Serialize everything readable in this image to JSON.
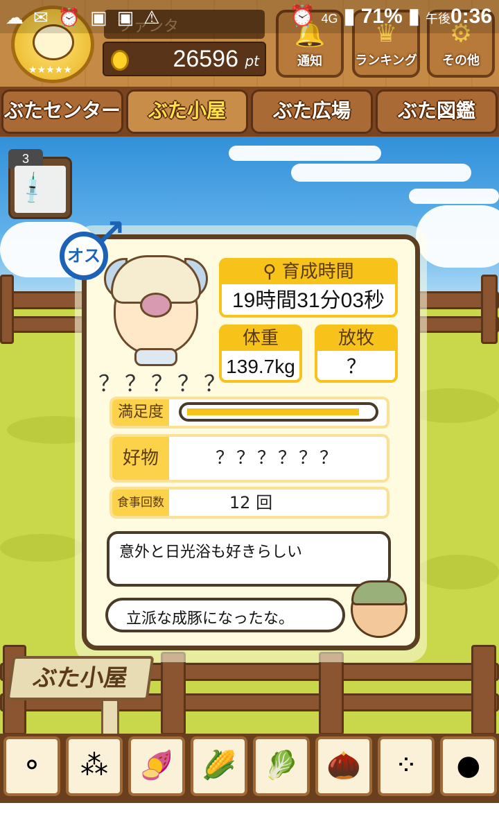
{
  "status_bar": {
    "battery_percent": "71%",
    "time_period": "午後",
    "time": "0:36",
    "network": "4G"
  },
  "header": {
    "player_name": "ファンタ",
    "points_value": "26596",
    "points_unit": "pt",
    "buttons": [
      {
        "label": "通知",
        "icon": "bell-icon"
      },
      {
        "label": "ランキング",
        "icon": "crown-icon"
      },
      {
        "label": "その他",
        "icon": "gear-icon"
      }
    ]
  },
  "tabs": [
    {
      "label": "ぶたセンター",
      "active": false
    },
    {
      "label": "ぶた小屋",
      "active": true
    },
    {
      "label": "ぶた広場",
      "active": false
    },
    {
      "label": "ぶた図鑑",
      "active": false
    }
  ],
  "item": {
    "count": "3",
    "icon": "syringe-icon"
  },
  "pig": {
    "gender": "オス",
    "name": "？？？？？",
    "growth_time_label": "育成時間",
    "growth_time_value": "19時間31分03秒",
    "weight_label": "体重",
    "weight_value": "139.7kg",
    "release_label": "放牧",
    "release_value": "？",
    "satisfaction_label": "満足度",
    "satisfaction_level": 0.94,
    "favorite_label": "好物",
    "favorite_value": "？？？？？？",
    "meals_label": "食事回数",
    "meals_value": "12 回",
    "hint": "意外と日光浴も好きらしい",
    "farmer_comment": "立派な成豚になったな。"
  },
  "signboard": "ぶた小屋",
  "foods": [
    {
      "name": "grain-pellets-icon"
    },
    {
      "name": "mixed-pellets-icon"
    },
    {
      "name": "sweet-potato-icon"
    },
    {
      "name": "corn-icon"
    },
    {
      "name": "vegetables-icon"
    },
    {
      "name": "acorns-icon"
    },
    {
      "name": "soybeans-icon"
    },
    {
      "name": "meatballs-icon"
    }
  ],
  "colors": {
    "accent_yellow": "#f7c21a",
    "wood_brown": "#5c3f22",
    "male_blue": "#1c63b8"
  }
}
